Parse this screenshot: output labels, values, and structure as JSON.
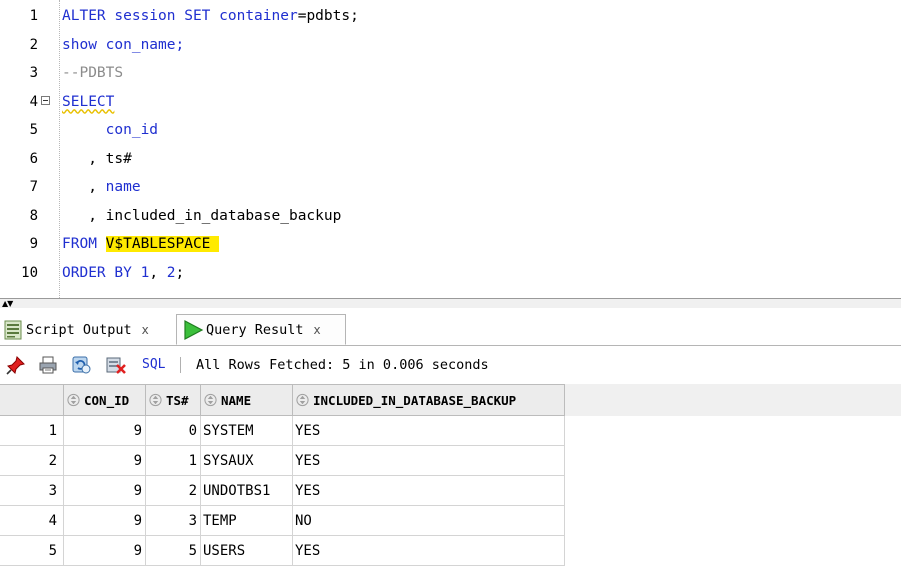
{
  "editor": {
    "lines": [
      {
        "num": "1",
        "tokens": [
          {
            "t": "ALTER session SET ",
            "c": "kw"
          },
          {
            "t": "container",
            "c": "ident"
          },
          {
            "t": "=pdbts;",
            "c": "plain"
          }
        ]
      },
      {
        "num": "2",
        "tokens": [
          {
            "t": "show con_name;",
            "c": "kw"
          }
        ]
      },
      {
        "num": "3",
        "tokens": [
          {
            "t": "--PDBTS",
            "c": "cmt"
          }
        ]
      },
      {
        "num": "4",
        "tokens": [
          {
            "t": "SELECT",
            "c": "kw squiggle"
          }
        ],
        "fold": true
      },
      {
        "num": "5",
        "tokens": [
          {
            "t": "     con_id",
            "c": "ident"
          }
        ]
      },
      {
        "num": "6",
        "tokens": [
          {
            "t": "   , ts#",
            "c": "plain"
          }
        ]
      },
      {
        "num": "7",
        "tokens": [
          {
            "t": "   , ",
            "c": "plain"
          },
          {
            "t": "name",
            "c": "ident"
          }
        ]
      },
      {
        "num": "8",
        "tokens": [
          {
            "t": "   , included_in_database_backup",
            "c": "plain"
          }
        ]
      },
      {
        "num": "9",
        "tokens": [
          {
            "t": "FROM ",
            "c": "kw"
          },
          {
            "t": "V$TABLESPACE ",
            "c": "plain hl"
          }
        ],
        "highlight_row": true
      },
      {
        "num": "10",
        "tokens": [
          {
            "t": "ORDER BY ",
            "c": "kw"
          },
          {
            "t": "1",
            "c": "num"
          },
          {
            "t": ", ",
            "c": "plain"
          },
          {
            "t": "2",
            "c": "num"
          },
          {
            "t": ";",
            "c": "plain"
          }
        ]
      }
    ]
  },
  "tabs": {
    "script_output": {
      "label": "Script Output",
      "close": "x"
    },
    "query_result": {
      "label": "Query Result",
      "close": "x"
    }
  },
  "toolbar": {
    "sql_label": "SQL",
    "status": "All Rows Fetched: 5 in 0.006 seconds"
  },
  "grid": {
    "columns": [
      "CON_ID",
      "TS#",
      "NAME",
      "INCLUDED_IN_DATABASE_BACKUP"
    ],
    "rows": [
      {
        "n": "1",
        "con_id": "9",
        "ts": "0",
        "name": "SYSTEM",
        "backup": "YES"
      },
      {
        "n": "2",
        "con_id": "9",
        "ts": "1",
        "name": "SYSAUX",
        "backup": "YES"
      },
      {
        "n": "3",
        "con_id": "9",
        "ts": "2",
        "name": "UNDOTBS1",
        "backup": "YES"
      },
      {
        "n": "4",
        "con_id": "9",
        "ts": "3",
        "name": "TEMP",
        "backup": "NO"
      },
      {
        "n": "5",
        "con_id": "9",
        "ts": "5",
        "name": "USERS",
        "backup": "YES"
      }
    ]
  },
  "colors": {
    "keyword": "#1f2fd0",
    "comment": "#8c8c8c",
    "current_line": "#eef0fb",
    "highlight": "#ffea00"
  },
  "icons": [
    "pin-icon",
    "print-icon",
    "refresh-icon",
    "export-icon",
    "play-icon",
    "script-icon",
    "sort-icon"
  ]
}
